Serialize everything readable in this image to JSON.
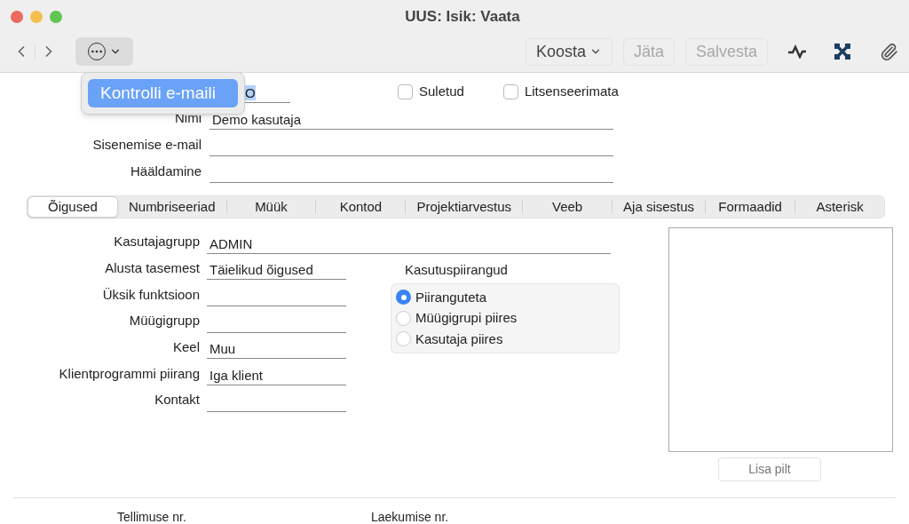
{
  "window": {
    "title": "UUS: Isik: Vaata"
  },
  "toolbar": {
    "buttons": [
      {
        "label": "Koosta",
        "kind": "menu",
        "disabled": false
      },
      {
        "label": "Jäta",
        "kind": "plain",
        "disabled": true
      },
      {
        "label": "Salvesta",
        "kind": "plain",
        "disabled": true
      }
    ]
  },
  "popup_menu": {
    "items": [
      {
        "label": "Kontrolli e-maili",
        "selected": true
      }
    ]
  },
  "header": {
    "first_field_value": "O",
    "checkboxes": [
      {
        "label": "Suletud",
        "checked": false
      },
      {
        "label": "Litsenseerimata",
        "checked": false
      }
    ],
    "fields": [
      {
        "label": "Nimi",
        "value": "Demo kasutaja"
      },
      {
        "label": "Sisenemise e-mail"
      },
      {
        "label": "Hääldamine"
      }
    ]
  },
  "tabs": [
    {
      "label": "Õigused",
      "selected": true
    },
    {
      "label": "Numbriseeriad",
      "selected": false
    },
    {
      "label": "Müük",
      "selected": false
    },
    {
      "label": "Kontod",
      "selected": false
    },
    {
      "label": "Projektiarvestus",
      "selected": false
    },
    {
      "label": "Veeb",
      "selected": false
    },
    {
      "label": "Aja sisestus",
      "selected": false
    },
    {
      "label": "Formaadid",
      "selected": false
    },
    {
      "label": "Asterisk",
      "selected": false
    }
  ],
  "rights": {
    "fields": [
      {
        "label": "Kasutajagrupp",
        "value": "ADMIN",
        "kind": "wide"
      },
      {
        "label": "Alusta tasemest",
        "value": "Täielikud õigused",
        "kind": "short"
      },
      {
        "label": "Üksik funktsioon",
        "kind": "short"
      },
      {
        "label": "Müügigrupp",
        "kind": "short"
      },
      {
        "label": "Keel",
        "value": "Muu",
        "kind": "short"
      },
      {
        "label": "Klientprogrammi piirang",
        "value": "Iga klient",
        "kind": "short"
      },
      {
        "label": "Kontakt",
        "kind": "short"
      }
    ],
    "restrictions": {
      "title": "Kasutuspiirangud",
      "options": [
        {
          "label": "Piiranguteta",
          "selected": true
        },
        {
          "label": "Müügigrupi piires",
          "selected": false
        },
        {
          "label": "Kasutaja piires",
          "selected": false
        }
      ]
    },
    "image_button": "Lisa pilt"
  },
  "footer": {
    "labels": [
      "Tellimuse nr.",
      "Laekumise nr."
    ]
  }
}
